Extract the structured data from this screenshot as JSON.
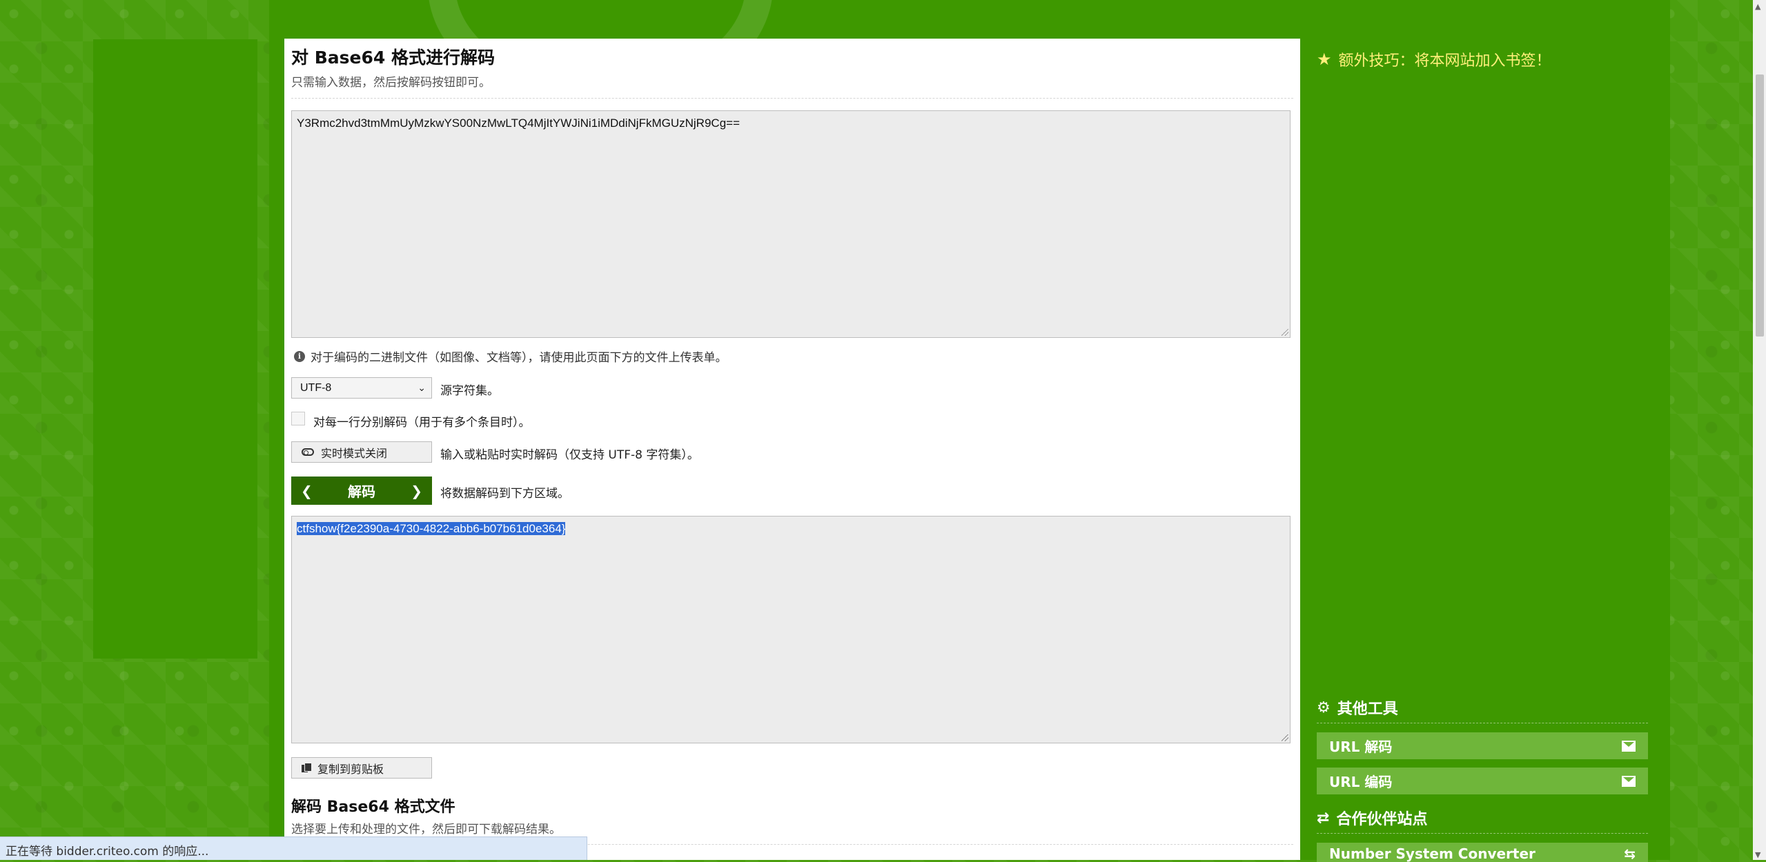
{
  "main": {
    "title": "对 Base64 格式进行解码",
    "subtitle": "只需输入数据，然后按解码按钮即可。",
    "input_value": "Y3Rmc2hvd3tmMmUyMzkwYS00NzMwLTQ4MjItYWJiNi1iMDdiNjFkMGUzNjR9Cg==",
    "info_text": "对于编码的二进制文件（如图像、文档等），请使用此页面下方的文件上传表单。",
    "charset_value": "UTF-8",
    "charset_label": "源字符集。",
    "per_line_label": "对每一行分别解码（用于有多个条目时）。",
    "live_mode_button": "实时模式关闭",
    "live_mode_label": "输入或粘贴时实时解码（仅支持 UTF-8 字符集）。",
    "decode_button": "解码",
    "decode_label": "将数据解码到下方区域。",
    "output_value": "ctfshow{f2e2390a-4730-4822-abb6-b07b61d0e364}",
    "copy_button": "复制到剪贴板",
    "file_title": "解码 Base64 格式文件",
    "file_subtitle": "选择要上传和处理的文件，然后即可下载解码结果。"
  },
  "sidebar": {
    "tip": "额外技巧：将本网站加入书签！",
    "other_tools_title": "其他工具",
    "tools": [
      {
        "label": "URL 解码",
        "icon": "envelope-open-icon"
      },
      {
        "label": "URL 编码",
        "icon": "envelope-icon"
      }
    ],
    "partners_title": "合作伙伴站点",
    "partners": [
      {
        "label": "Number System Converter",
        "icon": "exchange-icon"
      }
    ]
  },
  "status_bar": {
    "text": "正在等待 bidder.criteo.com 的响应..."
  },
  "colors": {
    "page_green": "#3e9800",
    "decode_button": "#2d6b00",
    "sidebar_button": "#6fb63a",
    "tip_yellow": "#ffef7a",
    "selection_blue": "#2f6bd6"
  }
}
